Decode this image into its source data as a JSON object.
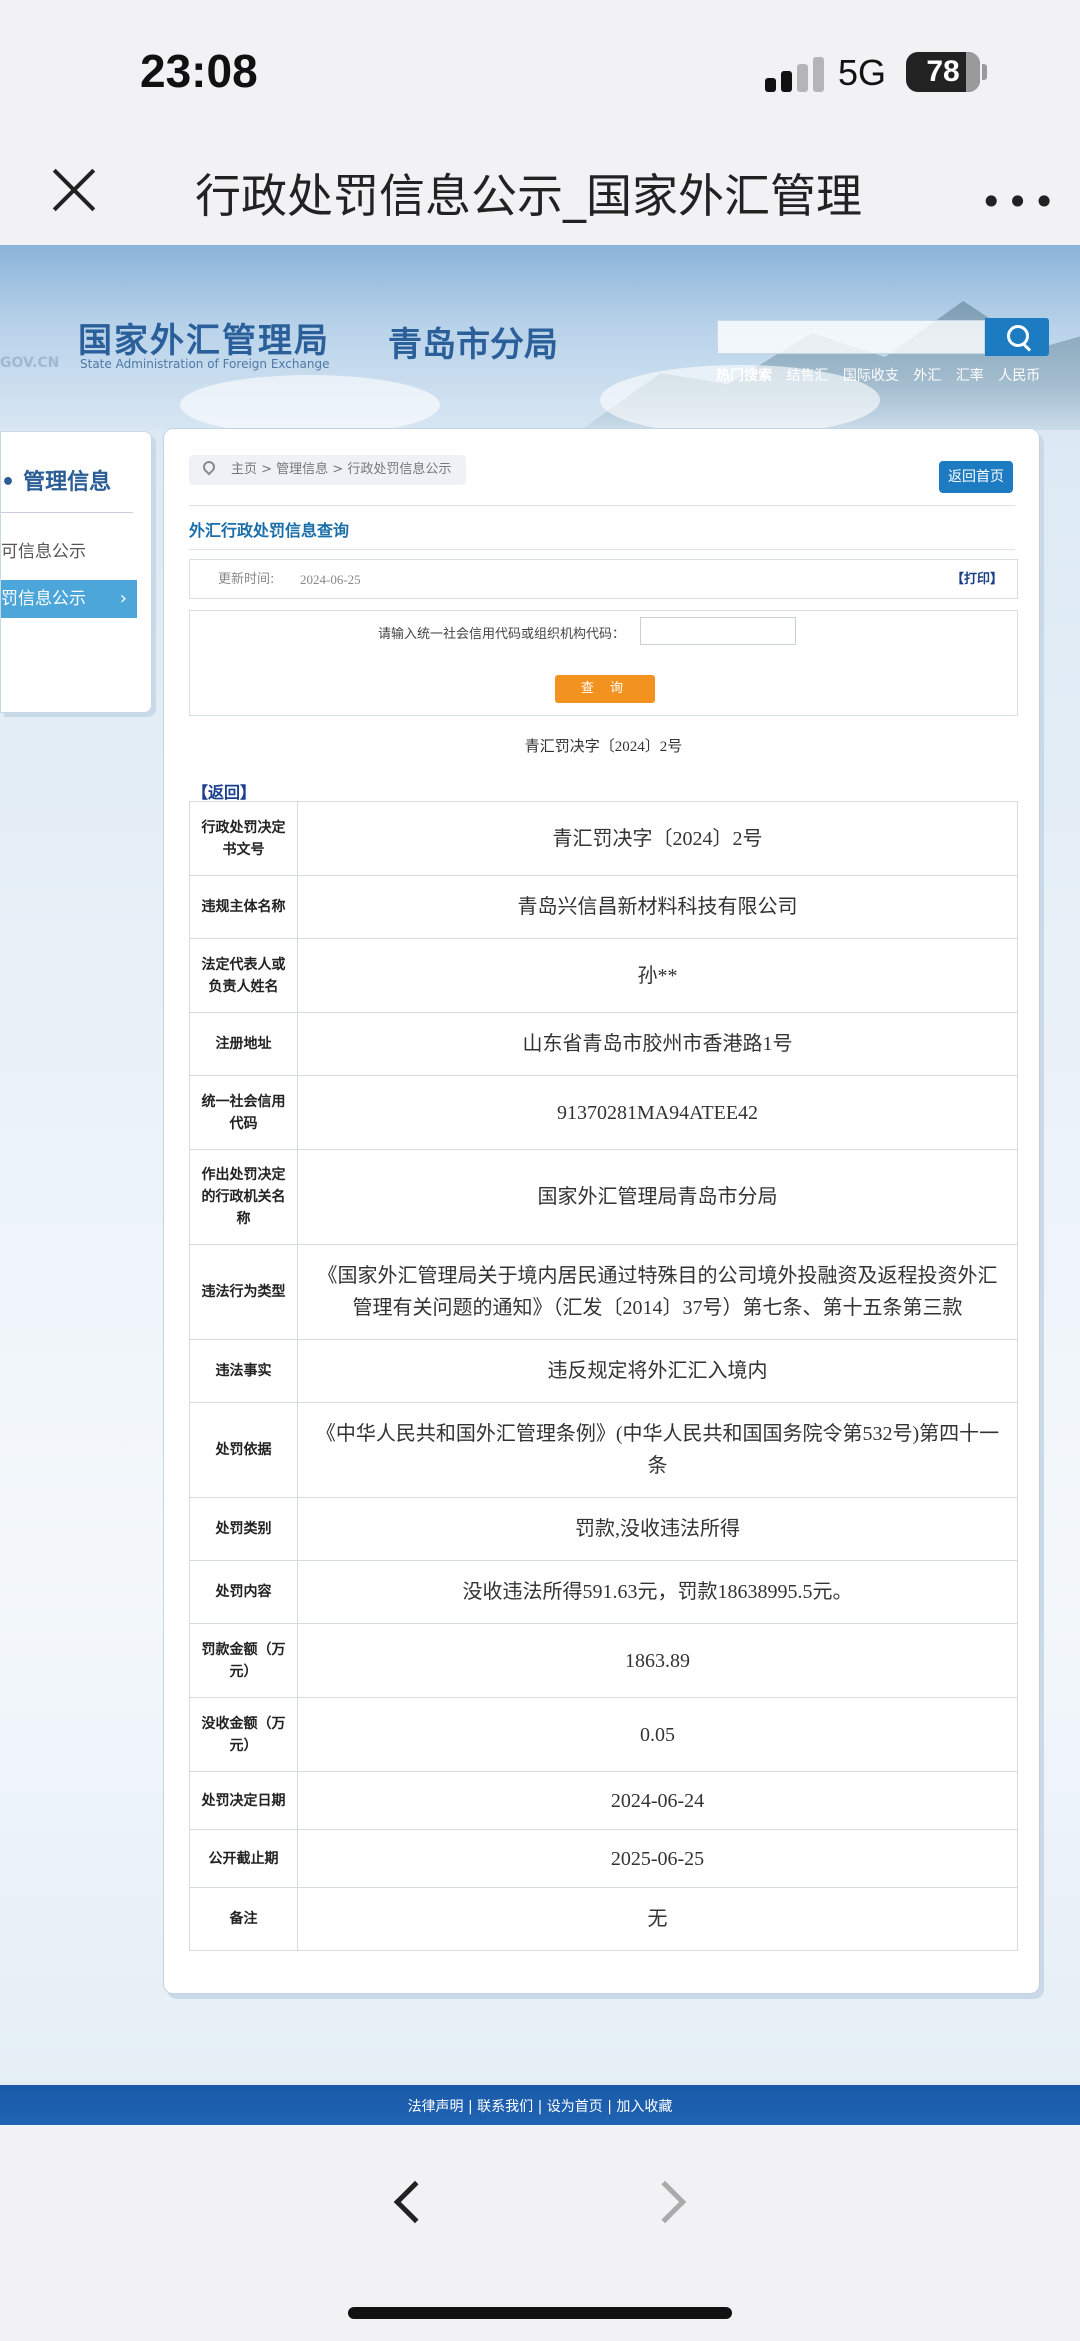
{
  "status_bar": {
    "time": "23:08",
    "network": "5G",
    "battery": "78"
  },
  "browser": {
    "title": "行政处罚信息公示_国家外汇管理"
  },
  "site": {
    "logo_main": "国家外汇管理局",
    "logo_sub": "State Administration of Foreign Exchange",
    "logo_gov": "GOV.CN",
    "branch": "青岛市分局",
    "hot_label": "热门搜索",
    "hot_words": [
      "结售汇",
      "国际收支",
      "外汇",
      "汇率",
      "人民币"
    ]
  },
  "sidebar": {
    "title": "管理信息",
    "items": [
      {
        "label": "可信息公示"
      },
      {
        "label": "罚信息公示"
      }
    ]
  },
  "panel": {
    "breadcrumb": "主页 > 管理信息 > 行政处罚信息公示",
    "home_button": "返回首页",
    "query_title": "外汇行政处罚信息查询",
    "update_label": "更新时间:",
    "update_value": "2024-06-25",
    "print_label": "【打印】",
    "query_label": "请输入统一社会信用代码或组织机构代码：",
    "query_input_value": "",
    "query_button": "查 询",
    "doc_no": "青汇罚决字〔2024〕2号",
    "back_link": "【返回】"
  },
  "table": [
    {
      "key": "行政处罚决定书文号",
      "value": "青汇罚决字〔2024〕2号"
    },
    {
      "key": "违规主体名称",
      "value": "青岛兴信昌新材料科技有限公司"
    },
    {
      "key": "法定代表人或负责人姓名",
      "value": "孙**"
    },
    {
      "key": "注册地址",
      "value": "山东省青岛市胶州市香港路1号"
    },
    {
      "key": "统一社会信用代码",
      "value": "91370281MA94ATEE42"
    },
    {
      "key": "作出处罚决定的行政机关名称",
      "value": "国家外汇管理局青岛市分局"
    },
    {
      "key": "违法行为类型",
      "value": "《国家外汇管理局关于境内居民通过特殊目的公司境外投融资及返程投资外汇管理有关问题的通知》（汇发〔2014〕37号）第七条、第十五条第三款"
    },
    {
      "key": "违法事实",
      "value": "违反规定将外汇汇入境内"
    },
    {
      "key": "处罚依据",
      "value": "《中华人民共和国外汇管理条例》(中华人民共和国国务院令第532号)第四十一条"
    },
    {
      "key": "处罚类别",
      "value": "罚款,没收违法所得"
    },
    {
      "key": "处罚内容",
      "value": "没收违法所得591.63元，罚款18638995.5元。"
    },
    {
      "key": "罚款金额（万元）",
      "value": "1863.89"
    },
    {
      "key": "没收金额（万元）",
      "value": "0.05"
    },
    {
      "key": "处罚决定日期",
      "value": "2024-06-24"
    },
    {
      "key": "公开截止期",
      "value": "2025-06-25"
    },
    {
      "key": "备注",
      "value": "无"
    }
  ],
  "footer": {
    "links": "法律声明 | 联系我们 | 设为首页 | 加入收藏"
  },
  "icons": {
    "close": "close-icon",
    "more": "more-icon",
    "search": "search-icon",
    "back": "back-arrow-icon",
    "forward": "forward-arrow-icon"
  },
  "colors": {
    "accent_blue": "#1c7bc1",
    "query_button": "#f2921f",
    "sidebar_active": "#4da6d9",
    "footer_bar": "#1f63b4"
  }
}
